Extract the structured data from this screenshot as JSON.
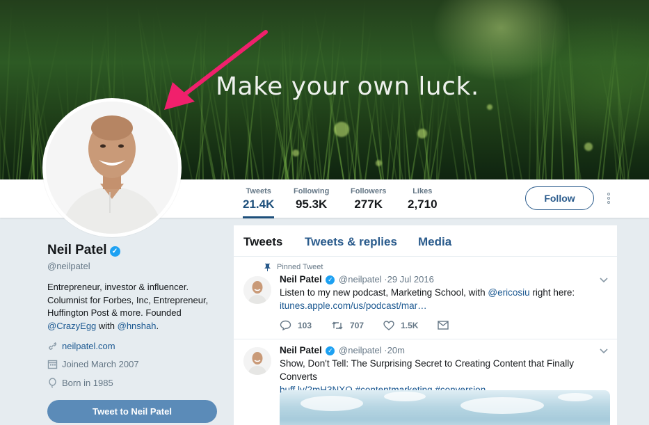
{
  "banner": {
    "quote": "Make your own luck."
  },
  "stats": [
    {
      "label": "Tweets",
      "value": "21.4K"
    },
    {
      "label": "Following",
      "value": "95.3K"
    },
    {
      "label": "Followers",
      "value": "277K"
    },
    {
      "label": "Likes",
      "value": "2,710"
    }
  ],
  "follow_label": "Follow",
  "profile": {
    "name": "Neil Patel",
    "handle": "@neilpatel",
    "bio_text": "Entrepreneur, investor & influencer. Columnist for Forbes, Inc, Entrepreneur, Huffington Post & more. Founded",
    "bio_mention1": "@CrazyEgg",
    "bio_with": " with ",
    "bio_mention2": "@hnshah",
    "bio_end": ".",
    "website": "neilpatel.com",
    "joined": "Joined March 2007",
    "born": "Born in 1985",
    "tweet_to_label": "Tweet to Neil Patel"
  },
  "tabs": [
    "Tweets",
    "Tweets & replies",
    "Media"
  ],
  "tweets": [
    {
      "pinned_label": "Pinned Tweet",
      "name": "Neil Patel",
      "handle": "@neilpatel",
      "time": "·29 Jul 2016",
      "text_before": "Listen to my new podcast, Marketing School, with ",
      "mention": "@ericosiu",
      "text_after": " right here:",
      "link": "itunes.apple.com/us/podcast/mar…",
      "replies": "103",
      "retweets": "707",
      "likes": "1.5K"
    },
    {
      "name": "Neil Patel",
      "handle": "@neilpatel",
      "time": "·20m",
      "text": "Show, Don't Tell: The Surprising Secret to Creating Content that Finally Converts",
      "link": "buff.ly/2mH3NXO",
      "hashtag1": "#contentmarketing",
      "hashtag2": "#conversion"
    }
  ],
  "colors": {
    "accent": "#1d4f7b",
    "link": "#1b5891",
    "verified": "#1da1f2",
    "arrow": "#f0206c"
  }
}
